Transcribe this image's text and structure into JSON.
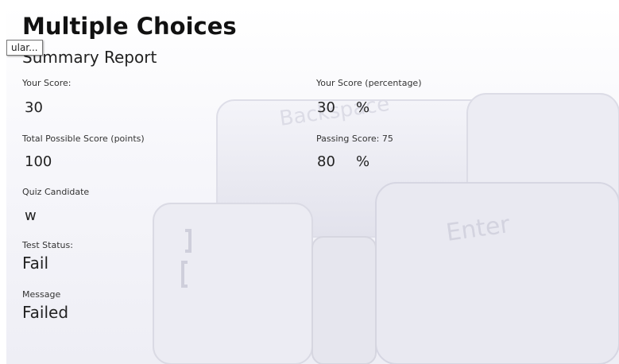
{
  "quiz": {
    "title": "Multiple Choices",
    "subtitle": "Summary Report",
    "tooltip": "ular..."
  },
  "report": {
    "your_score_label": "Your Score:",
    "your_score_value": "30",
    "your_score_pct_label": "Your Score (percentage)",
    "your_score_pct_value": "30",
    "total_possible_label": "Total Possible Score (points)",
    "total_possible_value": "100",
    "passing_score_label": "Passing Score: 75",
    "passing_score_value": "80",
    "percent_sign": "%",
    "candidate_label": "Quiz Candidate",
    "candidate_value": "w",
    "status_label": "Test Status:",
    "status_value": "Fail",
    "message_label": "Message",
    "message_value": "Failed"
  },
  "background": {
    "key_backspace": "Backspace",
    "key_enter": "Enter"
  }
}
